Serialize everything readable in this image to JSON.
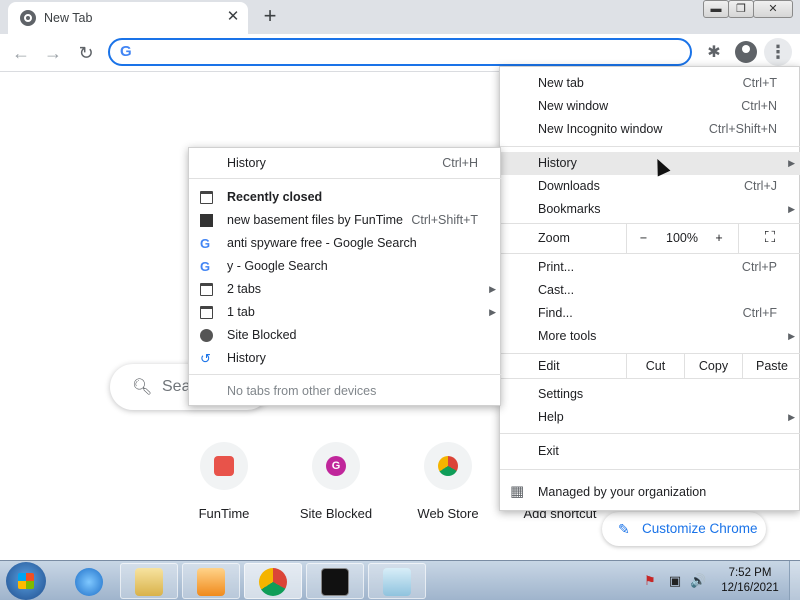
{
  "tab": {
    "title": "New Tab",
    "close": "✕"
  },
  "newtab_symbol": "+",
  "window_controls": [
    "▬",
    "❐",
    "✕"
  ],
  "toolbar": {
    "back": "←",
    "forward": "→",
    "reload": "↻",
    "omnibox_value": "",
    "extensions": "✱",
    "menu": "⋮",
    "google_letter": "G"
  },
  "page": {
    "search_placeholder": "Sea",
    "shortcuts": [
      {
        "label": "FunTime"
      },
      {
        "label": "Site Blocked",
        "letter": "G"
      },
      {
        "label": "Web Store"
      },
      {
        "label": "Add shortcut"
      }
    ],
    "customize_label": "Customize Chrome",
    "customize_icon": "✎"
  },
  "menu": {
    "new_tab": {
      "label": "New tab",
      "shortcut": "Ctrl+T"
    },
    "new_window": {
      "label": "New window",
      "shortcut": "Ctrl+N"
    },
    "new_incognito": {
      "label": "New Incognito window",
      "shortcut": "Ctrl+Shift+N"
    },
    "history": {
      "label": "History",
      "arrow": "▶"
    },
    "downloads": {
      "label": "Downloads",
      "shortcut": "Ctrl+J"
    },
    "bookmarks": {
      "label": "Bookmarks",
      "arrow": "▶"
    },
    "zoom": {
      "label": "Zoom",
      "minus": "−",
      "value": "100%",
      "plus": "+",
      "fullscreen": "⛶"
    },
    "print": {
      "label": "Print...",
      "shortcut": "Ctrl+P"
    },
    "cast": {
      "label": "Cast..."
    },
    "find": {
      "label": "Find...",
      "shortcut": "Ctrl+F"
    },
    "more_tools": {
      "label": "More tools",
      "arrow": "▶"
    },
    "edit": {
      "label": "Edit",
      "cut": "Cut",
      "copy": "Copy",
      "paste": "Paste"
    },
    "settings": {
      "label": "Settings"
    },
    "help": {
      "label": "Help",
      "arrow": "▶"
    },
    "exit": {
      "label": "Exit"
    },
    "managed": {
      "label": "Managed by your organization",
      "icon": "▦"
    }
  },
  "history_submenu": {
    "history": {
      "label": "History",
      "shortcut": "Ctrl+H"
    },
    "recently_closed": "Recently closed",
    "items": [
      {
        "label": "new basement files by FunTime",
        "shortcut": "Ctrl+Shift+T",
        "icon": "dark"
      },
      {
        "label": "anti spyware free - Google Search",
        "icon": "g"
      },
      {
        "label": "y - Google Search",
        "icon": "g"
      },
      {
        "label": "2 tabs",
        "icon": "win",
        "arrow": "▶"
      },
      {
        "label": "1 tab",
        "icon": "win",
        "arrow": "▶"
      },
      {
        "label": "Site Blocked",
        "icon": "globe"
      },
      {
        "label": "History",
        "icon": "history"
      }
    ],
    "no_tabs": "No tabs from other devices",
    "g_letter": "G",
    "history_glyph": "↺"
  },
  "taskbar": {
    "tray": [
      "⚑",
      "▣",
      "🔊"
    ],
    "time": "7:52 PM",
    "date": "12/16/2021"
  }
}
